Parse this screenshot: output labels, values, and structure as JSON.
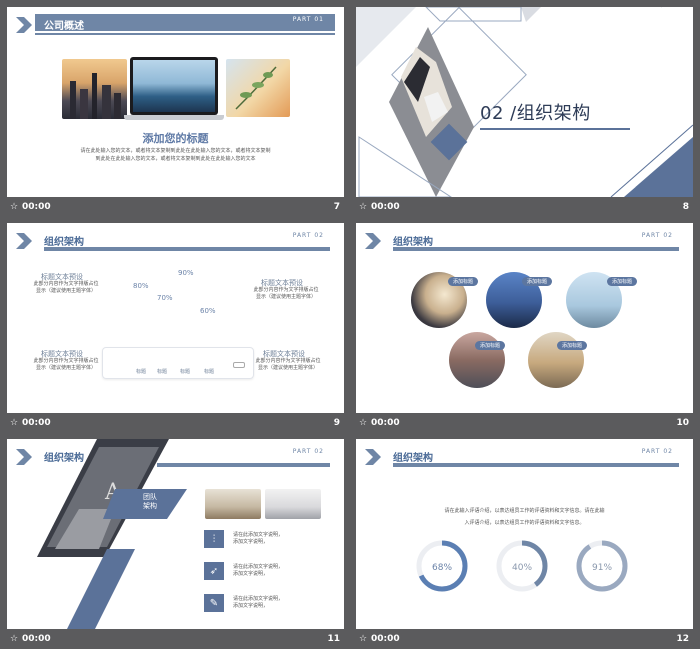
{
  "colors": {
    "accent": "#5b7299",
    "dark_background": "#5b5b5d",
    "bar_color": "#6f86a6"
  },
  "footer": {
    "time": "00:00"
  },
  "slides": [
    {
      "number": "7",
      "title": "公司概述",
      "part": "PART 01",
      "subtitle": "添加您的标题",
      "body_line1": "请在此处输入您的文本，或者将文本复制到此处在此处输入您的文本，或者将文本复制",
      "body_line2": "到此处在此处输入您的文本，或者将文本复制到此处在此处输入您的文本"
    },
    {
      "number": "8",
      "heading": "02 /组织架构"
    },
    {
      "number": "9",
      "title": "组织架构",
      "part": "PART 02",
      "percent_values": [
        "90%",
        "80%",
        "70%",
        "60%"
      ],
      "blocks": [
        {
          "title": "标题文本预设",
          "desc": "此部分内容作为文字排版占位显示（建议使用主题字体）"
        },
        {
          "title": "标题文本预设",
          "desc": "此部分内容作为文字排版占位显示（建议使用主题字体）"
        },
        {
          "title": "标题文本预设",
          "desc": "此部分内容作为文字排版占位显示（建议使用主题字体）"
        },
        {
          "title": "标题文本预设",
          "desc": "此部分内容作为文字排版占位显示（建议使用主题字体）"
        }
      ],
      "bar_labels": [
        "标题",
        "标题",
        "标题",
        "标题"
      ]
    },
    {
      "number": "10",
      "title": "组织架构",
      "part": "PART 02",
      "tags": [
        "添加标题",
        "添加标题",
        "添加标题",
        "添加标题",
        "添加标题"
      ]
    },
    {
      "number": "11",
      "title": "组织架构",
      "part": "PART 02",
      "team_label_line1": "团队",
      "team_label_line2": "架构",
      "items": [
        {
          "icon": "sitemap-icon",
          "line1": "请在此添加文字说明，",
          "line2": "添加文字说明，"
        },
        {
          "icon": "rocket-icon",
          "line1": "请在此添加文字说明，",
          "line2": "添加文字说明，"
        },
        {
          "icon": "pencil-icon",
          "line1": "请在此添加文字说明，",
          "line2": "添加文字说明，"
        }
      ]
    },
    {
      "number": "12",
      "title": "组织架构",
      "part": "PART 02",
      "intro_line1": "请在此输入评语介绍，以表达组员工作的评语资料和文字信息。请在此输",
      "intro_line2": "入评语介绍，以表达组员工作的评语资料和文字信息。",
      "progress": [
        {
          "label": "68%",
          "value": 68
        },
        {
          "label": "40%",
          "value": 40
        },
        {
          "label": "91%",
          "value": 91
        }
      ]
    }
  ]
}
